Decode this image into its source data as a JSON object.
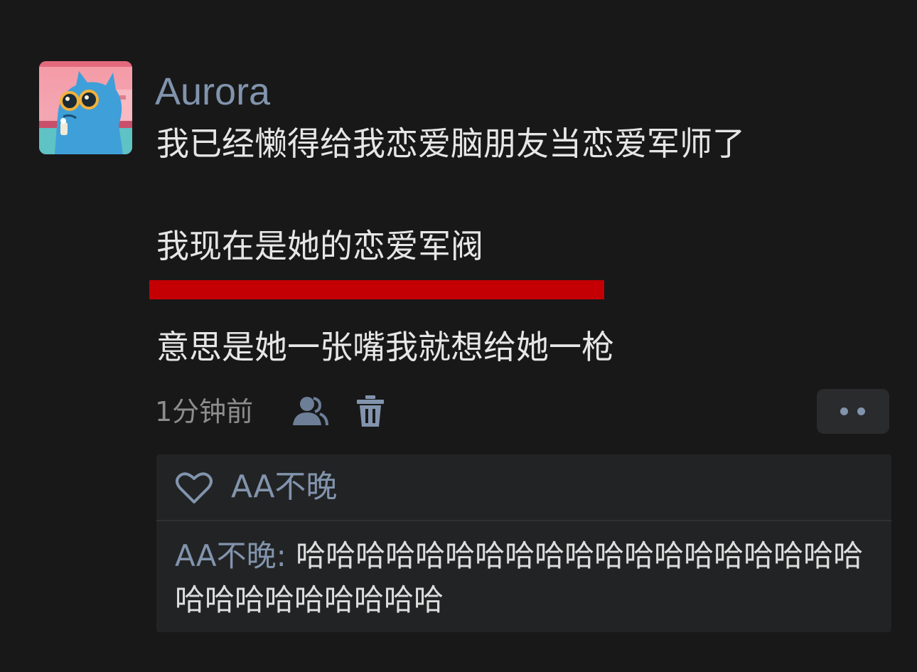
{
  "post": {
    "avatar_icon": "cartoon-blue-cat-with-sunglasses",
    "username": "Aurora",
    "lines": [
      "我已经懒得给我恋爱脑朋友当恋爱军师了",
      "我现在是她的恋爱军阀",
      "意思是她一张嘴我就想给她一枪"
    ],
    "timestamp": "1分钟前",
    "visibility_icon": "contacts-icon",
    "delete_icon": "trash-icon",
    "more_icon": "more-dots-icon"
  },
  "interactions": {
    "like_icon": "heart-icon",
    "likes": "AA不晚",
    "comments": [
      {
        "author": "AA不晚",
        "separator": ": ",
        "text": "哈哈哈哈哈哈哈哈哈哈哈哈哈哈哈哈哈哈哈哈哈哈哈哈哈哈哈哈"
      }
    ]
  },
  "colors": {
    "background": "#181819",
    "username": "#8194ad",
    "body_text": "#e6e6e6",
    "timestamp": "#8d8d8d",
    "highlight_underline": "#c40005",
    "panel": "#222324"
  }
}
